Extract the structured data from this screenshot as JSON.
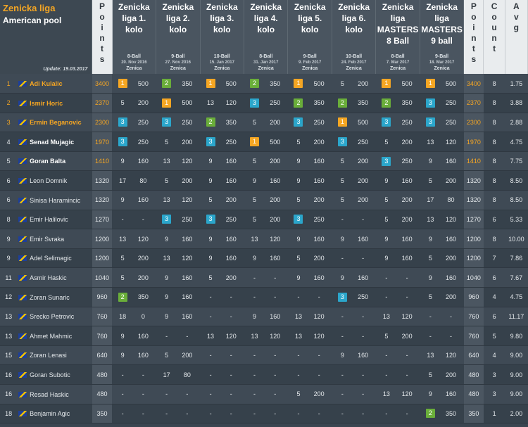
{
  "header": {
    "league": "Zenicka liga",
    "discipline": "American pool",
    "update": "Update: 19.03.2017",
    "points_label": [
      "P",
      "o",
      "i",
      "n",
      "t",
      "s"
    ],
    "count_label": [
      "C",
      "o",
      "u",
      "n",
      "t"
    ],
    "avg_label": [
      "A",
      "v",
      "g"
    ]
  },
  "rounds": [
    {
      "name": "Zenicka liga 1. kolo",
      "game": "8-Ball",
      "date": "20. Nov 2016",
      "city": "Zenica"
    },
    {
      "name": "Zenicka liga 2. kolo",
      "game": "9-Ball",
      "date": "27. Nov 2016",
      "city": "Zenica"
    },
    {
      "name": "Zenicka liga 3. kolo",
      "game": "10-Ball",
      "date": "15. Jan 2017",
      "city": "Zenica"
    },
    {
      "name": "Zenicka liga 4. kolo",
      "game": "8-Ball",
      "date": "31. Jan 2017",
      "city": "Zenica"
    },
    {
      "name": "Zenicka liga 5. kolo",
      "game": "9-Ball",
      "date": "9. Feb 2017",
      "city": "Zenica"
    },
    {
      "name": "Zenicka liga 6. kolo",
      "game": "10-Ball",
      "date": "24. Feb 2017",
      "city": "Zenica"
    },
    {
      "name": "Zenicka liga MASTERS 8 Ball",
      "game": "8-Ball",
      "date": "7. Mar 2017",
      "city": "Zenica"
    },
    {
      "name": "Zenicka liga MASTERS 9 ball",
      "game": "9-Ball",
      "date": "18. Mar 2017",
      "city": "Zenica"
    }
  ],
  "players": [
    {
      "rank": "1",
      "name": "Adi Kulalic",
      "points": "3400",
      "results": [
        [
          "1",
          "500"
        ],
        [
          "2",
          "350"
        ],
        [
          "1",
          "500"
        ],
        [
          "2",
          "350"
        ],
        [
          "1",
          "500"
        ],
        [
          "5",
          "200"
        ],
        [
          "1",
          "500"
        ],
        [
          "1",
          "500"
        ]
      ],
      "points2": "3400",
      "count": "8",
      "avg": "1.75"
    },
    {
      "rank": "2",
      "name": "Ismir Horic",
      "points": "2370",
      "results": [
        [
          "5",
          "200"
        ],
        [
          "1",
          "500"
        ],
        [
          "13",
          "120"
        ],
        [
          "3",
          "250"
        ],
        [
          "2",
          "350"
        ],
        [
          "2",
          "350"
        ],
        [
          "2",
          "350"
        ],
        [
          "3",
          "250"
        ]
      ],
      "points2": "2370",
      "count": "8",
      "avg": "3.88"
    },
    {
      "rank": "3",
      "name": "Ermin Beganovic",
      "points": "2300",
      "results": [
        [
          "3",
          "250"
        ],
        [
          "3",
          "250"
        ],
        [
          "2",
          "350"
        ],
        [
          "5",
          "200"
        ],
        [
          "3",
          "250"
        ],
        [
          "1",
          "500"
        ],
        [
          "3",
          "250"
        ],
        [
          "3",
          "250"
        ]
      ],
      "points2": "2300",
      "count": "8",
      "avg": "2.88"
    },
    {
      "rank": "4",
      "name": "Senad Mujagic",
      "points": "1970",
      "results": [
        [
          "3",
          "250"
        ],
        [
          "5",
          "200"
        ],
        [
          "3",
          "250"
        ],
        [
          "1",
          "500"
        ],
        [
          "5",
          "200"
        ],
        [
          "3",
          "250"
        ],
        [
          "5",
          "200"
        ],
        [
          "13",
          "120"
        ]
      ],
      "points2": "1970",
      "count": "8",
      "avg": "4.75"
    },
    {
      "rank": "5",
      "name": "Goran Balta",
      "points": "1410",
      "results": [
        [
          "9",
          "160"
        ],
        [
          "13",
          "120"
        ],
        [
          "9",
          "160"
        ],
        [
          "5",
          "200"
        ],
        [
          "9",
          "160"
        ],
        [
          "5",
          "200"
        ],
        [
          "3",
          "250"
        ],
        [
          "9",
          "160"
        ]
      ],
      "points2": "1410",
      "count": "8",
      "avg": "7.75"
    },
    {
      "rank": "6",
      "name": "Leon Domnik",
      "points": "1320",
      "results": [
        [
          "17",
          "80"
        ],
        [
          "5",
          "200"
        ],
        [
          "9",
          "160"
        ],
        [
          "9",
          "160"
        ],
        [
          "9",
          "160"
        ],
        [
          "5",
          "200"
        ],
        [
          "9",
          "160"
        ],
        [
          "5",
          "200"
        ]
      ],
      "points2": "1320",
      "count": "8",
      "avg": "8.50"
    },
    {
      "rank": "6",
      "name": "Sinisa Haramincic",
      "points": "1320",
      "results": [
        [
          "9",
          "160"
        ],
        [
          "13",
          "120"
        ],
        [
          "5",
          "200"
        ],
        [
          "5",
          "200"
        ],
        [
          "5",
          "200"
        ],
        [
          "5",
          "200"
        ],
        [
          "5",
          "200"
        ],
        [
          "17",
          "80"
        ]
      ],
      "points2": "1320",
      "count": "8",
      "avg": "8.50"
    },
    {
      "rank": "8",
      "name": "Emir Halilovic",
      "points": "1270",
      "results": [
        [
          "-",
          "-"
        ],
        [
          "3",
          "250"
        ],
        [
          "3",
          "250"
        ],
        [
          "5",
          "200"
        ],
        [
          "3",
          "250"
        ],
        [
          "-",
          "-"
        ],
        [
          "5",
          "200"
        ],
        [
          "13",
          "120"
        ]
      ],
      "points2": "1270",
      "count": "6",
      "avg": "5.33"
    },
    {
      "rank": "9",
      "name": "Emir Svraka",
      "points": "1200",
      "results": [
        [
          "13",
          "120"
        ],
        [
          "9",
          "160"
        ],
        [
          "9",
          "160"
        ],
        [
          "13",
          "120"
        ],
        [
          "9",
          "160"
        ],
        [
          "9",
          "160"
        ],
        [
          "9",
          "160"
        ],
        [
          "9",
          "160"
        ]
      ],
      "points2": "1200",
      "count": "8",
      "avg": "10.00"
    },
    {
      "rank": "9",
      "name": "Adel Selimagic",
      "points": "1200",
      "results": [
        [
          "5",
          "200"
        ],
        [
          "13",
          "120"
        ],
        [
          "9",
          "160"
        ],
        [
          "9",
          "160"
        ],
        [
          "5",
          "200"
        ],
        [
          "-",
          "-"
        ],
        [
          "9",
          "160"
        ],
        [
          "5",
          "200"
        ]
      ],
      "points2": "1200",
      "count": "7",
      "avg": "7.86"
    },
    {
      "rank": "11",
      "name": "Asmir Haskic",
      "points": "1040",
      "results": [
        [
          "5",
          "200"
        ],
        [
          "9",
          "160"
        ],
        [
          "5",
          "200"
        ],
        [
          "-",
          "-"
        ],
        [
          "9",
          "160"
        ],
        [
          "9",
          "160"
        ],
        [
          "-",
          "-"
        ],
        [
          "9",
          "160"
        ]
      ],
      "points2": "1040",
      "count": "6",
      "avg": "7.67"
    },
    {
      "rank": "12",
      "name": "Zoran Sunaric",
      "points": "960",
      "results": [
        [
          "2",
          "350"
        ],
        [
          "9",
          "160"
        ],
        [
          "-",
          "-"
        ],
        [
          "-",
          "-"
        ],
        [
          "-",
          "-"
        ],
        [
          "3",
          "250"
        ],
        [
          "-",
          "-"
        ],
        [
          "5",
          "200"
        ]
      ],
      "points2": "960",
      "count": "4",
      "avg": "4.75"
    },
    {
      "rank": "13",
      "name": "Srecko Petrovic",
      "points": "760",
      "results": [
        [
          "18",
          "0"
        ],
        [
          "9",
          "160"
        ],
        [
          "-",
          "-"
        ],
        [
          "9",
          "160"
        ],
        [
          "13",
          "120"
        ],
        [
          "-",
          "-"
        ],
        [
          "13",
          "120"
        ],
        [
          "-",
          "-"
        ]
      ],
      "points2": "760",
      "count": "6",
      "avg": "11.17"
    },
    {
      "rank": "13",
      "name": "Ahmet Mahmic",
      "points": "760",
      "results": [
        [
          "9",
          "160"
        ],
        [
          "-",
          "-"
        ],
        [
          "13",
          "120"
        ],
        [
          "13",
          "120"
        ],
        [
          "13",
          "120"
        ],
        [
          "-",
          "-"
        ],
        [
          "5",
          "200"
        ],
        [
          "-",
          "-"
        ]
      ],
      "points2": "760",
      "count": "5",
      "avg": "9.80"
    },
    {
      "rank": "15",
      "name": "Zoran Lenasi",
      "points": "640",
      "results": [
        [
          "9",
          "160"
        ],
        [
          "5",
          "200"
        ],
        [
          "-",
          "-"
        ],
        [
          "-",
          "-"
        ],
        [
          "-",
          "-"
        ],
        [
          "9",
          "160"
        ],
        [
          "-",
          "-"
        ],
        [
          "13",
          "120"
        ]
      ],
      "points2": "640",
      "count": "4",
      "avg": "9.00"
    },
    {
      "rank": "16",
      "name": "Goran Subotic",
      "points": "480",
      "results": [
        [
          "-",
          "-"
        ],
        [
          "17",
          "80"
        ],
        [
          "-",
          "-"
        ],
        [
          "-",
          "-"
        ],
        [
          "-",
          "-"
        ],
        [
          "-",
          "-"
        ],
        [
          "-",
          "-"
        ],
        [
          "5",
          "200"
        ]
      ],
      "points2": "480",
      "count": "3",
      "avg": "9.00"
    },
    {
      "rank": "16",
      "name": "Resad Haskic",
      "points": "480",
      "results": [
        [
          "-",
          "-"
        ],
        [
          "-",
          "-"
        ],
        [
          "-",
          "-"
        ],
        [
          "-",
          "-"
        ],
        [
          "5",
          "200"
        ],
        [
          "-",
          "-"
        ],
        [
          "13",
          "120"
        ],
        [
          "9",
          "160"
        ]
      ],
      "points2": "480",
      "count": "3",
      "avg": "9.00"
    },
    {
      "rank": "18",
      "name": "Benjamin Agic",
      "points": "350",
      "results": [
        [
          "-",
          "-"
        ],
        [
          "-",
          "-"
        ],
        [
          "-",
          "-"
        ],
        [
          "-",
          "-"
        ],
        [
          "-",
          "-"
        ],
        [
          "-",
          "-"
        ],
        [
          "-",
          "-"
        ],
        [
          "2",
          "350"
        ]
      ],
      "points2": "350",
      "count": "1",
      "avg": "2.00"
    }
  ]
}
